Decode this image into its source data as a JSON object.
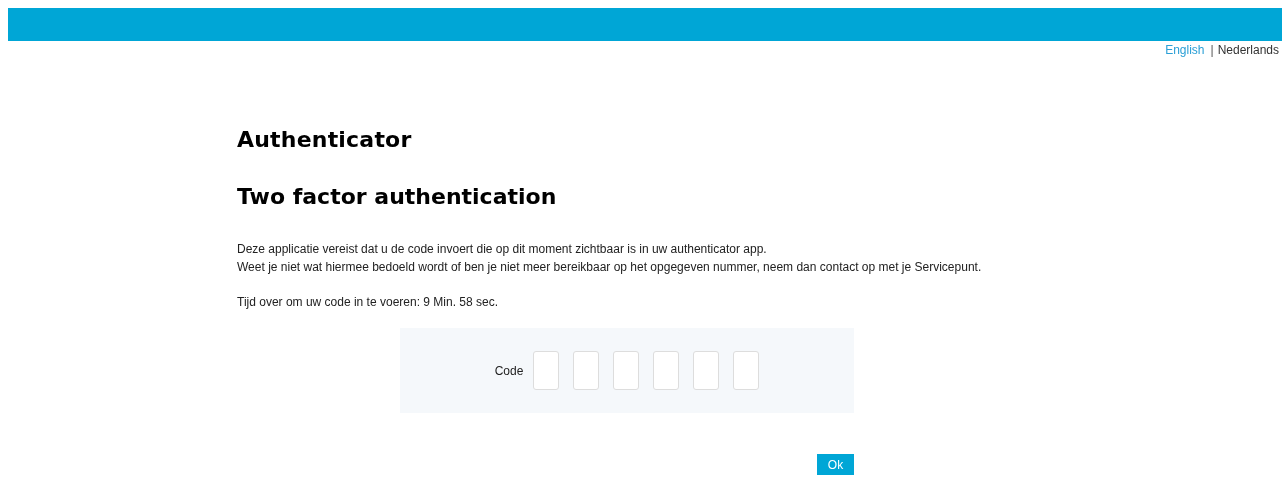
{
  "languages": [
    {
      "label": "English",
      "selected": false
    },
    {
      "label": "Nederlands",
      "selected": true
    }
  ],
  "language_separator": "|",
  "title": "Authenticator",
  "subtitle": "Two factor authentication",
  "intro": [
    "Deze applicatie vereist dat u de code invoert die op dit moment zichtbaar is in uw authenticator app.",
    "Weet je niet wat hiermee bedoeld wordt of ben je niet meer bereikbaar op het opgegeven nummer, neem dan contact op met je Servicepunt."
  ],
  "timer": "Tijd over om uw code in te voeren: 9 Min. 58 sec.",
  "code": {
    "label": "Code"
  },
  "ok_button": "Ok"
}
